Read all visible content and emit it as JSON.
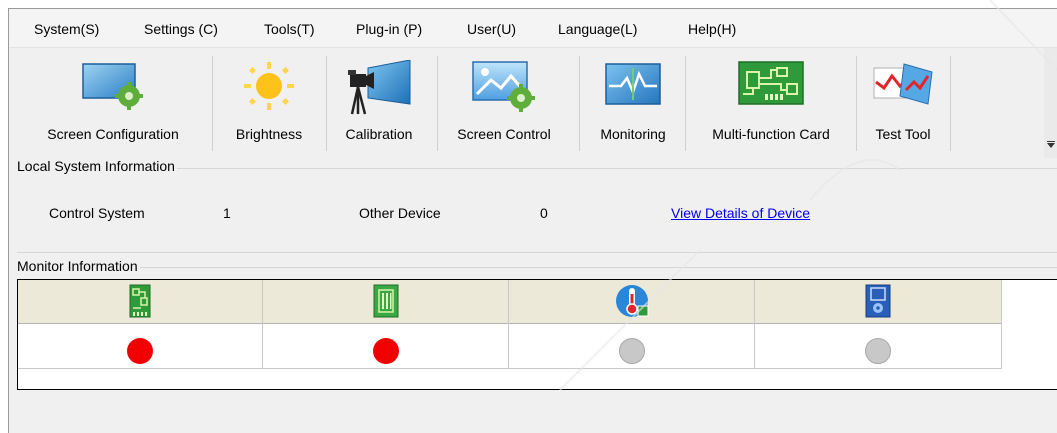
{
  "menu": [
    {
      "label": "System(S)"
    },
    {
      "label": "Settings (C)"
    },
    {
      "label": "Tools(T)"
    },
    {
      "label": "Plug-in (P)"
    },
    {
      "label": "User(U)"
    },
    {
      "label": "Language(L)"
    },
    {
      "label": "Help(H)"
    }
  ],
  "toolbar": [
    {
      "label": "Screen Configuration",
      "icon": "screen-config-icon"
    },
    {
      "label": "Brightness",
      "icon": "sun-icon"
    },
    {
      "label": "Calibration",
      "icon": "camera-tripod-icon"
    },
    {
      "label": "Screen Control",
      "icon": "screen-control-icon"
    },
    {
      "label": "Monitoring",
      "icon": "monitor-wave-icon"
    },
    {
      "label": "Multi-function Card",
      "icon": "circuit-board-icon"
    },
    {
      "label": "Test Tool",
      "icon": "chart-test-icon"
    }
  ],
  "local_system": {
    "title": "Local System Information",
    "control_system_label": "Control System",
    "control_system_value": "1",
    "other_device_label": "Other Device",
    "other_device_value": "0",
    "view_details_link": "View Details of Device"
  },
  "monitor": {
    "title": "Monitor Information",
    "columns": [
      {
        "icon": "sending-card-icon",
        "status": "red"
      },
      {
        "icon": "receiving-card-icon",
        "status": "red"
      },
      {
        "icon": "thermometer-icon",
        "status": "gray"
      },
      {
        "icon": "fan-card-icon",
        "status": "gray"
      }
    ]
  },
  "colors": {
    "status_red": "#f00000",
    "status_gray": "#c8c8c8",
    "link": "#0000ee"
  }
}
